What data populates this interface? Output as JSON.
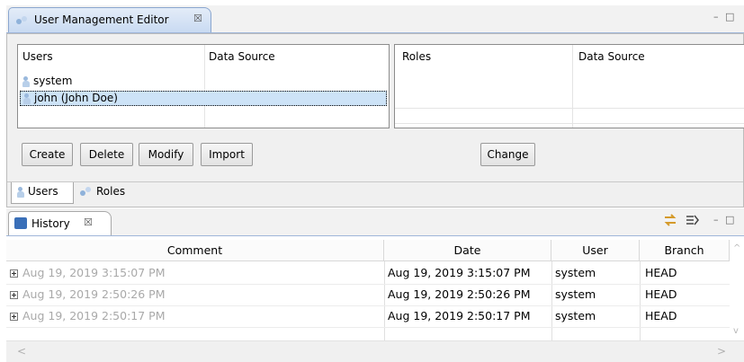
{
  "editor": {
    "tab_title": "User Management Editor",
    "close_glyph": "☒",
    "minmax_glyph": "– □",
    "users_table": {
      "headers": [
        "Users",
        "Data Source"
      ],
      "rows": [
        {
          "name": "system",
          "source": ""
        },
        {
          "name": "john (John Doe)",
          "source": ""
        }
      ]
    },
    "roles_table": {
      "headers": [
        "Roles",
        "Data Source"
      ]
    },
    "buttons": {
      "create": "Create",
      "delete": "Delete",
      "modify": "Modify",
      "import": "Import",
      "change": "Change"
    },
    "bottom_tabs": [
      "Users",
      "Roles"
    ]
  },
  "history": {
    "tab_title": "History",
    "close_glyph": "☒",
    "minmax_glyph": "– □",
    "columns": [
      "Comment",
      "Date",
      "User",
      "Branch"
    ],
    "rows": [
      {
        "comment": "Aug 19, 2019 3:15:07 PM",
        "date": "Aug 19, 2019 3:15:07 PM",
        "user": "system",
        "branch": "HEAD"
      },
      {
        "comment": "Aug 19, 2019 2:50:26 PM",
        "date": "Aug 19, 2019 2:50:26 PM",
        "user": "system",
        "branch": "HEAD"
      },
      {
        "comment": "Aug 19, 2019 2:50:17 PM",
        "date": "Aug 19, 2019 2:50:17 PM",
        "user": "system",
        "branch": "HEAD"
      }
    ],
    "scroll_left": "<",
    "scroll_right": ">",
    "scroll_up": "^",
    "scroll_down": "v"
  },
  "colors": {
    "accent_tab": "#c9daf2",
    "selection": "#cde3f7",
    "muted_text": "#a9a9a9"
  }
}
